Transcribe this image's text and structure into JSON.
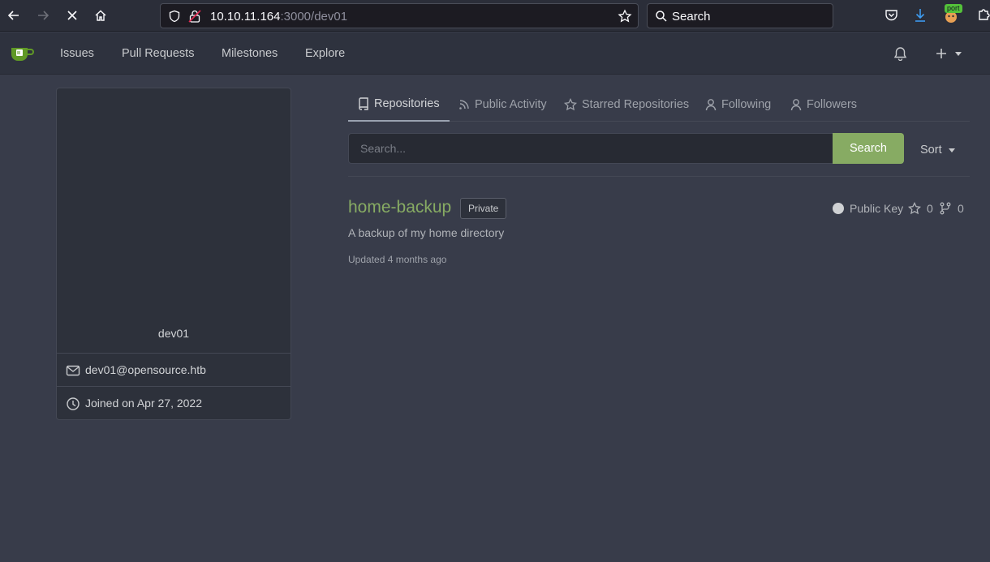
{
  "browser": {
    "url_host": "10.10.11.164",
    "url_rest": ":3000/dev01",
    "search_placeholder": "Search",
    "extension_badge": "port"
  },
  "nav": {
    "links": [
      "Issues",
      "Pull Requests",
      "Milestones",
      "Explore"
    ]
  },
  "profile": {
    "username": "dev01",
    "email": "dev01@opensource.htb",
    "joined": "Joined on Apr 27, 2022"
  },
  "tabs": [
    {
      "label": "Repositories",
      "icon": "repo-icon",
      "active": true
    },
    {
      "label": "Public Activity",
      "icon": "rss-icon",
      "active": false
    },
    {
      "label": "Starred Repositories",
      "icon": "star-icon",
      "active": false
    },
    {
      "label": "Following",
      "icon": "person-icon",
      "active": false
    },
    {
      "label": "Followers",
      "icon": "person-icon",
      "active": false
    }
  ],
  "repo_search": {
    "placeholder": "Search...",
    "button": "Search",
    "sort": "Sort"
  },
  "repos": [
    {
      "name": "home-backup",
      "badge": "Private",
      "language": "Public Key",
      "stars": "0",
      "forks": "0",
      "description": "A backup of my home directory",
      "updated": "Updated 4 months ago"
    }
  ],
  "colors": {
    "accent_green": "#87ab63",
    "background": "#383c4a",
    "nav_bg": "#2e323e"
  }
}
